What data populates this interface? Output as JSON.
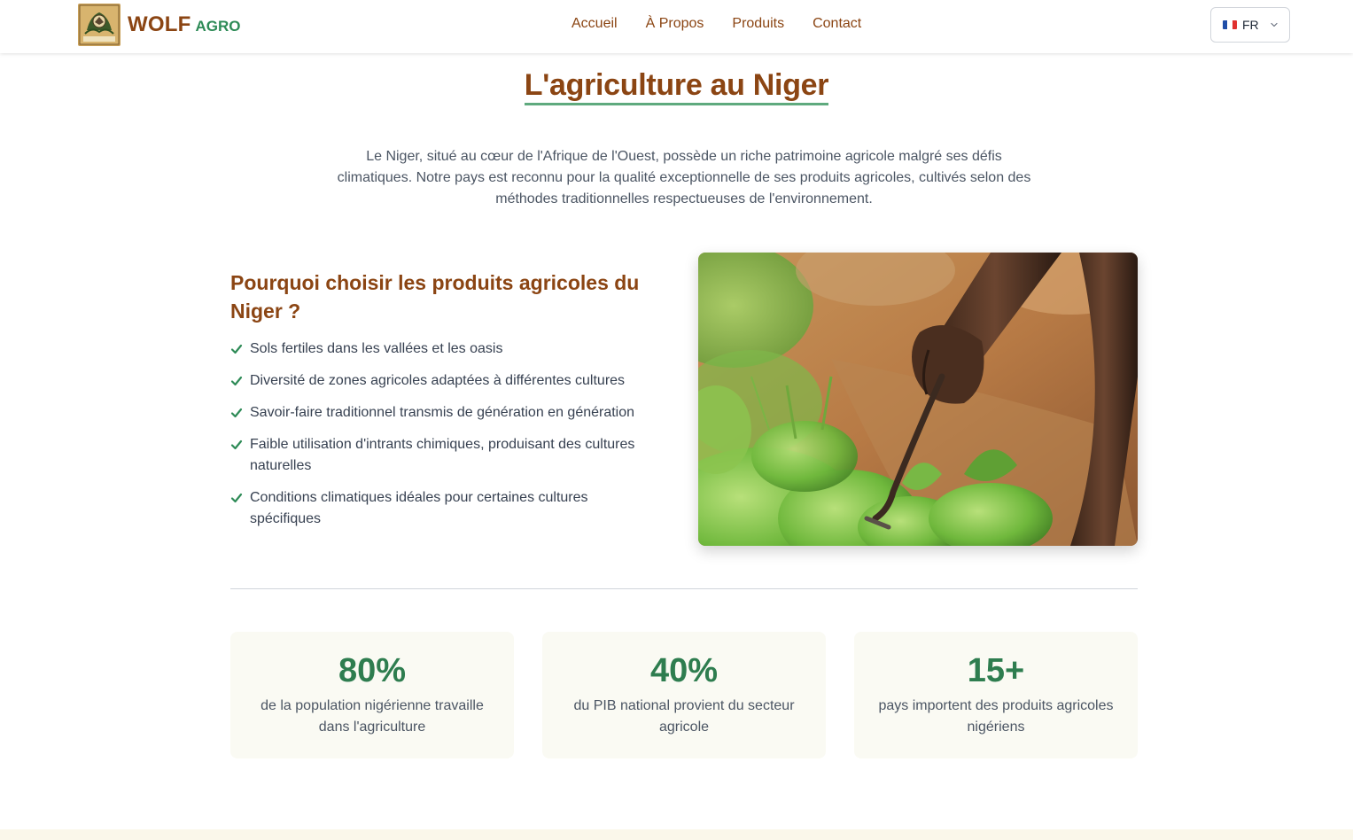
{
  "header": {
    "brand_primary": "WOLF",
    "brand_secondary": "AGRO",
    "logo_text": "WOLF AGRO",
    "nav": [
      {
        "label": "Accueil"
      },
      {
        "label": "À Propos"
      },
      {
        "label": "Produits"
      },
      {
        "label": "Contact"
      }
    ],
    "language": {
      "label": "FR",
      "flag": "france-flag-icon"
    }
  },
  "main": {
    "title": "L'agriculture au Niger",
    "intro": "Le Niger, situé au cœur de l'Afrique de l'Ouest, possède un riche patrimoine agricole malgré ses défis climatiques. Notre pays est reconnu pour la qualité exceptionnelle de ses produits agricoles, cultivés selon des méthodes traditionnelles respectueuses de l'environnement.",
    "why": {
      "heading": "Pourquoi choisir les produits agricoles du Niger ?",
      "items": [
        {
          "text": "Sols fertiles dans les vallées et les oasis"
        },
        {
          "text": "Diversité de zones agricoles adaptées à différentes cultures"
        },
        {
          "text": "Savoir-faire traditionnel transmis de génération en génération"
        },
        {
          "text": "Faible utilisation d'intrants chimiques, produisant des cultures naturelles"
        },
        {
          "text": "Conditions climatiques idéales pour certaines cultures spécifiques"
        }
      ]
    },
    "stats": [
      {
        "value": "80%",
        "label": "de la population nigérienne travaille dans l'agriculture"
      },
      {
        "value": "40%",
        "label": "du PIB national provient du secteur agricole"
      },
      {
        "value": "15+",
        "label": "pays importent des produits agricoles nigériens"
      }
    ]
  },
  "colors": {
    "brand_brown": "#8b4513",
    "brand_green": "#2e8b57",
    "stat_green": "#2e7d4f",
    "card_bg": "#fafaf3"
  }
}
